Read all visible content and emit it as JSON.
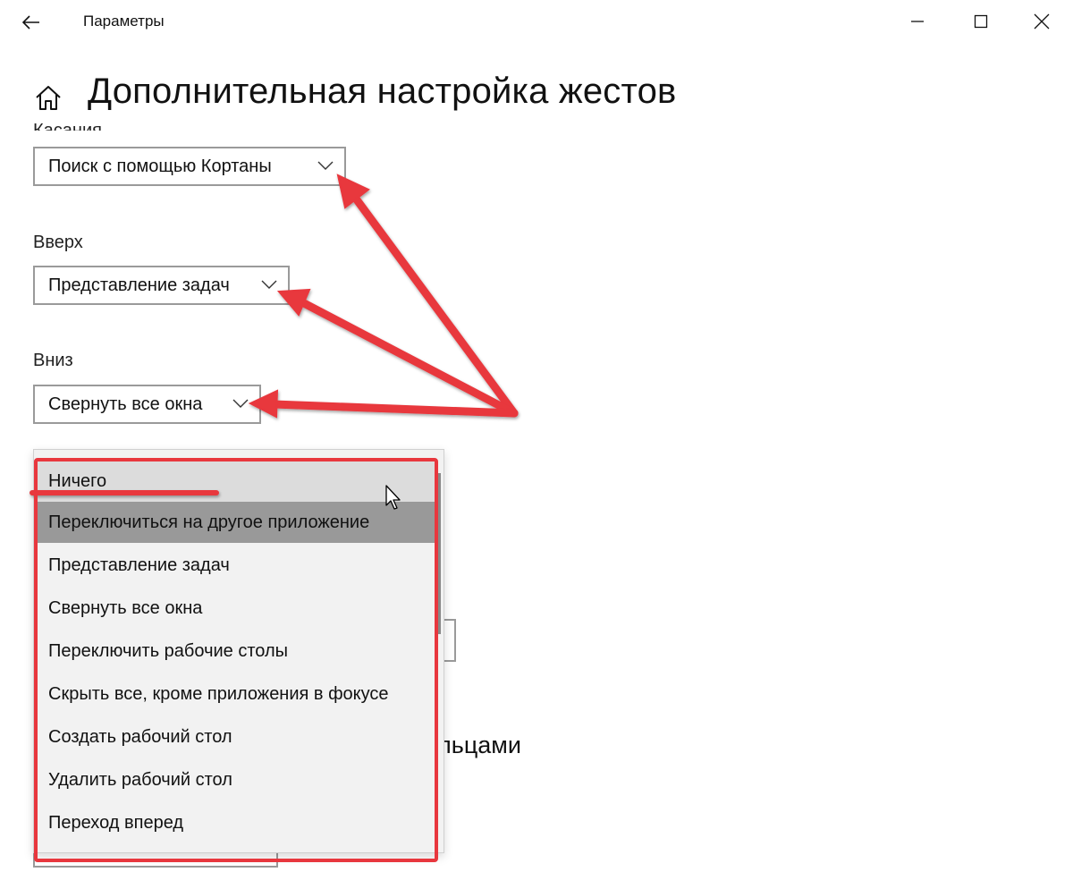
{
  "window": {
    "title": "Параметры",
    "controls": [
      "minimize",
      "maximize",
      "close"
    ]
  },
  "page": {
    "title": "Дополнительная настройка жестов",
    "clipped_section_label": "Касания"
  },
  "fields": [
    {
      "label": "",
      "value": "Поиск с помощью Кортаны"
    },
    {
      "label": "Вверх",
      "value": "Представление задач"
    },
    {
      "label": "Вниз",
      "value": "Свернуть все окна"
    }
  ],
  "dropdown": {
    "items": [
      {
        "label": "Ничего",
        "state": "hover"
      },
      {
        "label": "Переключиться на другое приложение",
        "state": "selected"
      },
      {
        "label": "Представление задач",
        "state": ""
      },
      {
        "label": "Свернуть все окна",
        "state": ""
      },
      {
        "label": "Переключить рабочие столы",
        "state": ""
      },
      {
        "label": "Скрыть все, кроме приложения в фокусе",
        "state": ""
      },
      {
        "label": "Создать рабочий стол",
        "state": ""
      },
      {
        "label": "Удалить рабочий стол",
        "state": ""
      },
      {
        "label": "Переход вперед",
        "state": ""
      }
    ]
  },
  "background": {
    "partial_heading": "льцами"
  },
  "icons": {
    "back": "back-arrow-icon",
    "home": "home-icon",
    "minimize": "minimize-icon",
    "maximize": "maximize-icon",
    "close": "close-icon",
    "chevron": "chevron-down-icon",
    "cursor": "mouse-cursor-icon"
  },
  "colors": {
    "annotation": "#e8373e",
    "selected_item": "#999999",
    "dropdown_bg": "#f2f2f2",
    "border": "#9a9a9a"
  }
}
